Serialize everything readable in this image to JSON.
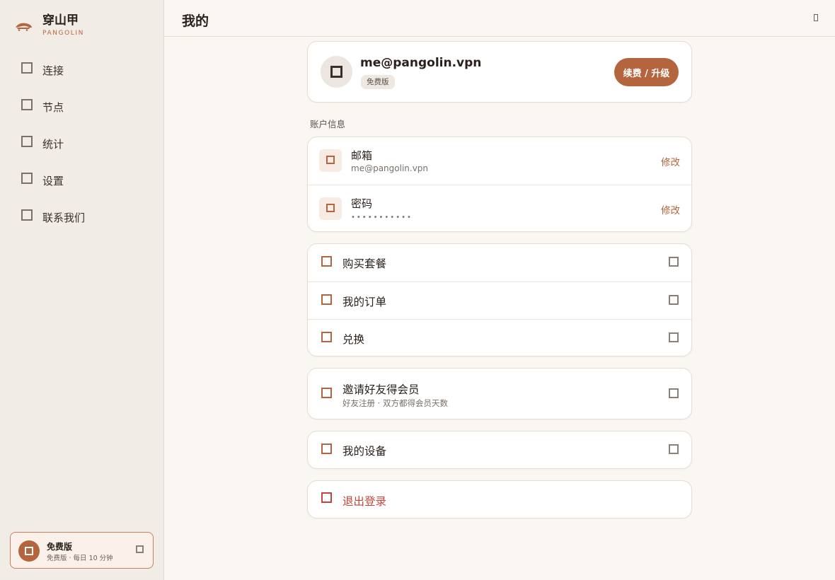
{
  "brand": {
    "name": "穿山甲",
    "subtitle": "PANGOLIN",
    "logo_icon": "pangolin-logo-icon",
    "accent": "#b4653d"
  },
  "sidebar": {
    "items": [
      {
        "label": "连接",
        "icon": "connect-icon"
      },
      {
        "label": "节点",
        "icon": "nodes-icon"
      },
      {
        "label": "统计",
        "icon": "stats-icon"
      },
      {
        "label": "设置",
        "icon": "settings-icon"
      },
      {
        "label": "联系我们",
        "icon": "contact-icon"
      }
    ],
    "plan": {
      "title": "免费版",
      "subtitle": "免费版 · 每日 10 分钟"
    }
  },
  "header": {
    "title": "我的"
  },
  "profile": {
    "email": "me@pangolin.vpn",
    "badge": "免费版",
    "upgrade_label": "续费 / 升级"
  },
  "account": {
    "section_label": "账户信息",
    "email": {
      "title": "邮箱",
      "value": "me@pangolin.vpn",
      "edit": "修改"
    },
    "password": {
      "title": "密码",
      "value": "•••••••••••",
      "edit": "修改"
    }
  },
  "menu": {
    "purchase": "购买套餐",
    "orders": "我的订单",
    "redeem": "兑换",
    "invite": {
      "title": "邀请好友得会员",
      "subtitle": "好友注册 · 双方都得会员天数"
    },
    "devices": "我的设备",
    "logout": "退出登录"
  },
  "colors": {
    "accent": "#b4653d",
    "danger": "#c2443a",
    "sidebar_bg": "#f2ece6",
    "page_bg": "#faf7f3"
  }
}
